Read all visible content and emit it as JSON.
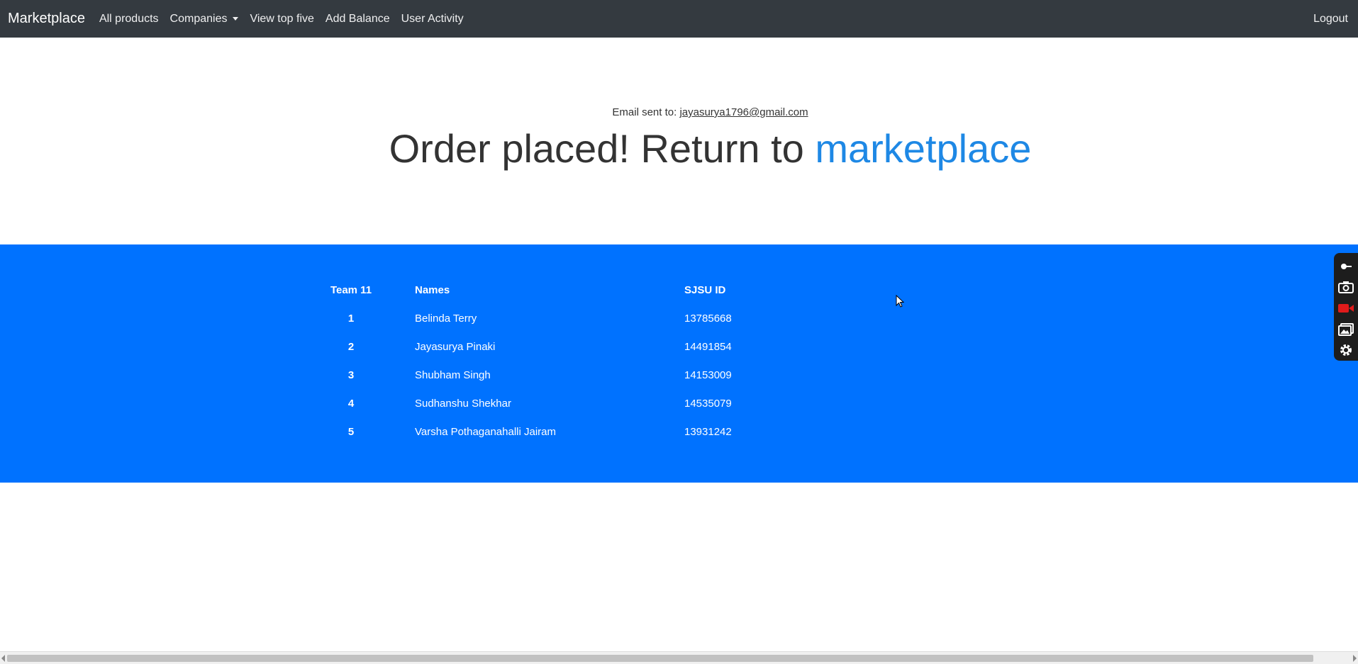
{
  "navbar": {
    "brand": "Marketplace",
    "links": [
      "All products",
      "Companies",
      "View top five",
      "Add Balance",
      "User Activity"
    ],
    "logout": "Logout"
  },
  "confirmation": {
    "email_prefix": "Email sent to:",
    "email": "jayasurya1796@gmail.com",
    "headline_text": "Order placed! Return to",
    "headline_link": "marketplace"
  },
  "team_table": {
    "headers": [
      "Team 11",
      "Names",
      "SJSU ID"
    ],
    "rows": [
      {
        "num": "1",
        "name": "Belinda Terry",
        "id": "13785668"
      },
      {
        "num": "2",
        "name": "Jayasurya Pinaki",
        "id": "14491854"
      },
      {
        "num": "3",
        "name": "Shubham Singh",
        "id": "14153009"
      },
      {
        "num": "4",
        "name": "Sudhanshu Shekhar",
        "id": "14535079"
      },
      {
        "num": "5",
        "name": "Varsha Pothaganahalli Jairam",
        "id": "13931242"
      }
    ]
  },
  "colors": {
    "navbar_bg": "#343a40",
    "footer_bg": "#0072ff",
    "link_accent": "#1e88e5"
  },
  "toolbar_icons": [
    "pin-icon",
    "camera-icon",
    "video-record-icon",
    "gallery-icon",
    "gear-icon"
  ]
}
